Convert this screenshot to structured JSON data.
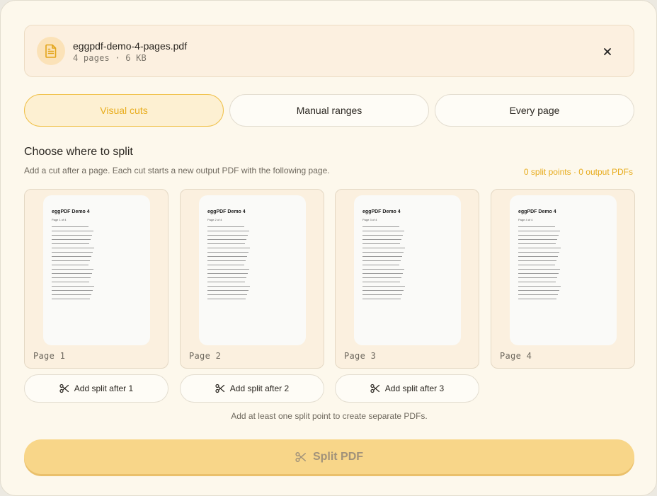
{
  "file": {
    "name": "eggpdf-demo-4-pages.pdf",
    "meta": "4 pages · 6 KB",
    "icon": "document-icon"
  },
  "tabs": [
    {
      "label": "Visual cuts",
      "active": true
    },
    {
      "label": "Manual ranges",
      "active": false
    },
    {
      "label": "Every page",
      "active": false
    }
  ],
  "section": {
    "title": "Choose where to split",
    "description": "Add a cut after a page. Each cut starts a new output PDF with the following page.",
    "counts": "0 split points · 0 output PDFs"
  },
  "pages": [
    {
      "label": "Page 1",
      "thumb_title": "eggPDF Demo 4",
      "thumb_sub": "Page 1 of 4"
    },
    {
      "label": "Page 2",
      "thumb_title": "eggPDF Demo 4",
      "thumb_sub": "Page 2 of 4"
    },
    {
      "label": "Page 3",
      "thumb_title": "eggPDF Demo 4",
      "thumb_sub": "Page 3 of 4"
    },
    {
      "label": "Page 4",
      "thumb_title": "eggPDF Demo 4",
      "thumb_sub": "Page 4 of 4"
    }
  ],
  "split_buttons": [
    {
      "label": "Add split after 1"
    },
    {
      "label": "Add split after 2"
    },
    {
      "label": "Add split after 3"
    }
  ],
  "hint": "Add at least one split point to create separate PDFs.",
  "primary": {
    "label": "Split PDF",
    "icon": "scissors-icon"
  },
  "colors": {
    "accent": "#e8ad1e",
    "primary_bg": "#f8d689",
    "panel_bg": "#fdf8ec"
  }
}
